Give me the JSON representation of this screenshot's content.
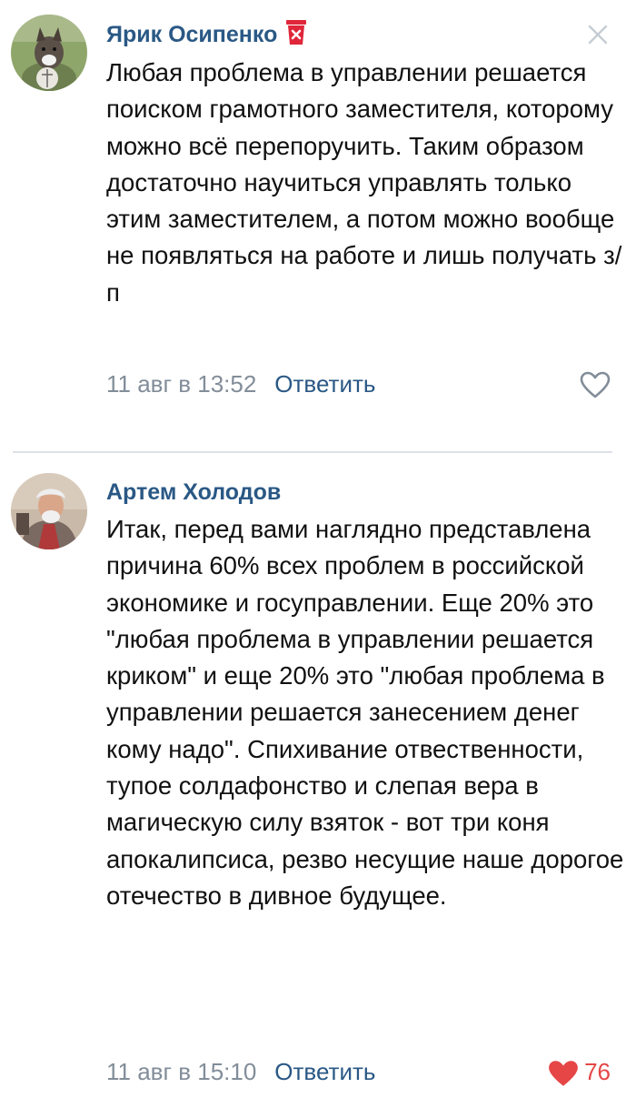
{
  "comments": [
    {
      "author": "Ярик Осипенко",
      "badge_icon": "red-cup-badge-icon",
      "text": "Любая проблема в управлении решается поиском грамотного заместителя, которому можно всё перепоручить. Таким образом достаточно научиться управлять только этим заместителем, а потом можно вообще не появляться на работе и лишь получать з/п",
      "date": "11 авг в 13:52",
      "reply_label": "Ответить",
      "liked": false
    },
    {
      "author": "Артем Холодов",
      "text": "Итак, перед вами наглядно представлена причина 60% всех проблем в российской экономике и госуправлении. Еще 20% это \"любая проблема в управлении решается криком\" и еще 20% это \"любая проблема в управлении решается занесением денег кому надо\". Спихивание отвественности, тупое солдафонство и слепая вера в магическую силу взяток - вот три коня апокалипсиса, резво несущие наше дорогое отечество в дивное будущее.",
      "date": "11 авг в 15:10",
      "reply_label": "Ответить",
      "liked": true,
      "likes": "76"
    }
  ],
  "colors": {
    "author": "#2a5885",
    "meta": "#828d99",
    "like": "#e64646",
    "divider": "#dce1e6"
  }
}
